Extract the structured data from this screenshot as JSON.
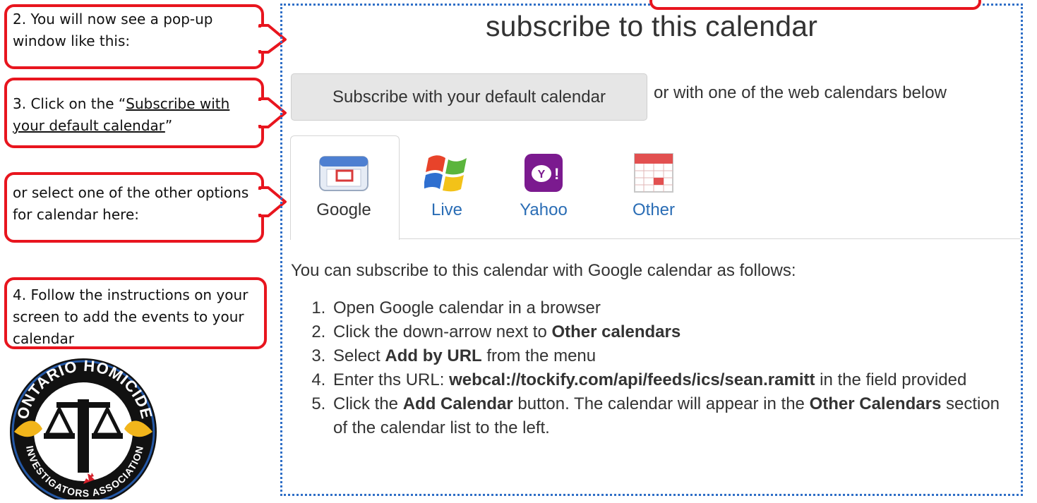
{
  "callouts": {
    "c2": "2. You will now see a pop-up window like this:",
    "c3_prefix": "3.  Click on the “",
    "c3_link": "Subscribe with your default calendar",
    "c3_suffix": "”",
    "c_or": "or select one of the other options for calendar here:",
    "c4": "4. Follow the instructions on your screen to add the events to your calendar"
  },
  "popup": {
    "title": "subscribe to this calendar",
    "subscribe_button": "Subscribe with your default calendar",
    "or_text": "or with one of the web calendars below",
    "tabs": [
      {
        "label": "Google",
        "icon": "google-calendar-icon",
        "active": true
      },
      {
        "label": "Live",
        "icon": "windows-live-icon",
        "active": false
      },
      {
        "label": "Yahoo",
        "icon": "yahoo-icon",
        "active": false
      },
      {
        "label": "Other",
        "icon": "calendar-grid-icon",
        "active": false
      }
    ],
    "intro": "You can subscribe to this calendar with Google calendar as follows:",
    "steps": [
      {
        "pre": "Open Google calendar in a browser",
        "b1": "",
        "mid": "",
        "b2": "",
        "post": ""
      },
      {
        "pre": "Click the down-arrow next to ",
        "b1": "Other calendars",
        "mid": "",
        "b2": "",
        "post": ""
      },
      {
        "pre": "Select ",
        "b1": "Add by URL",
        "mid": " from the menu",
        "b2": "",
        "post": ""
      },
      {
        "pre": "Enter ths URL: ",
        "b1": "webcal://tockify.com/api/feeds/ics/sean.ramitt",
        "mid": " in the field provided",
        "b2": "",
        "post": ""
      },
      {
        "pre": "Click the ",
        "b1": "Add Calendar",
        "mid": " button. The calendar will appear in the ",
        "b2": "Other Calendars",
        "post": " section of the calendar list to the left."
      }
    ]
  },
  "logo": {
    "text_top": "ONTARIO HOMICIDE",
    "text_bottom": "INVESTIGATORS ASSOCIATION"
  },
  "colors": {
    "callout_border": "#e8151e",
    "popup_border": "#2f6fc7",
    "link": "#2a6db5"
  }
}
